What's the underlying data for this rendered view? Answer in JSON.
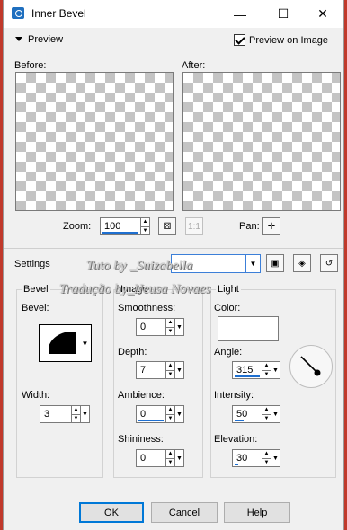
{
  "window": {
    "title": "Inner Bevel",
    "minimize": "—",
    "maximize": "☐",
    "close": "✕"
  },
  "preview": {
    "toggle_label": "Preview",
    "preview_on_image_label": "Preview on Image",
    "preview_on_image_checked": true,
    "before_label": "Before:",
    "after_label": "After:"
  },
  "zoom": {
    "label": "Zoom:",
    "value": "100",
    "pan_label": "Pan:"
  },
  "settings": {
    "label": "Settings",
    "preset_value": ""
  },
  "bevel_group": {
    "title": "Bevel",
    "bevel_label": "Bevel:",
    "width_label": "Width:",
    "width_value": "3"
  },
  "image_group": {
    "title": "Image",
    "smoothness_label": "Smoothness:",
    "smoothness_value": "0",
    "depth_label": "Depth:",
    "depth_value": "7",
    "ambience_label": "Ambience:",
    "ambience_value": "0",
    "shininess_label": "Shininess:",
    "shininess_value": "0"
  },
  "light_group": {
    "title": "Light",
    "color_label": "Color:",
    "color_value": "#ffffff",
    "angle_label": "Angle:",
    "angle_value": "315",
    "intensity_label": "Intensity:",
    "intensity_value": "50",
    "elevation_label": "Elevation:",
    "elevation_value": "30"
  },
  "buttons": {
    "ok": "OK",
    "cancel": "Cancel",
    "help": "Help"
  },
  "watermark": {
    "line1": "Tuto by _Suizabella",
    "line2": "Tradução by_Neusa Novaes"
  },
  "colors": {
    "accent": "#0078d7",
    "spin_underline": "#1e6fd0"
  }
}
